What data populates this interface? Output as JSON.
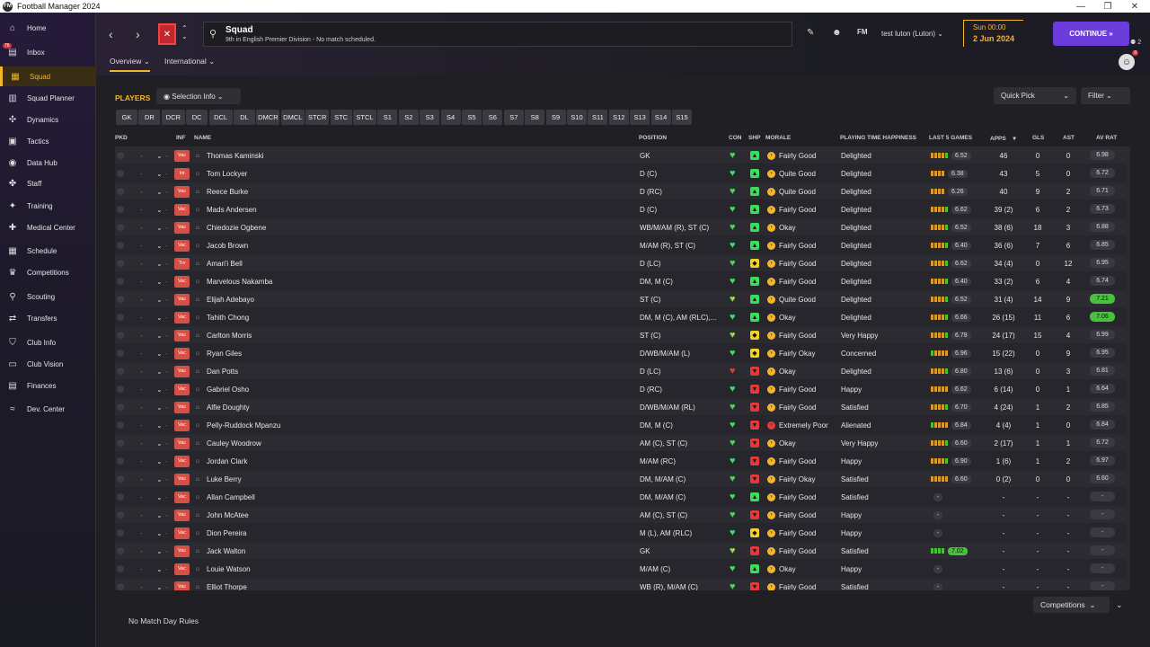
{
  "window": {
    "title": "Football Manager 2024",
    "logo": "FM"
  },
  "sidebar": {
    "items": [
      {
        "label": "Home",
        "icon": "home-icon",
        "glyph": "⌂",
        "badge": ""
      },
      {
        "label": "Inbox",
        "icon": "inbox-icon",
        "glyph": "▤",
        "badge": "76"
      },
      {
        "label": "Squad",
        "icon": "shirt-icon",
        "glyph": "▦",
        "badge": ""
      },
      {
        "label": "Squad Planner",
        "icon": "planner-icon",
        "glyph": "▥",
        "badge": ""
      },
      {
        "label": "Dynamics",
        "icon": "dynamics-icon",
        "glyph": "✣",
        "badge": ""
      },
      {
        "label": "Tactics",
        "icon": "tactics-icon",
        "glyph": "▣",
        "badge": ""
      },
      {
        "label": "Data Hub",
        "icon": "data-hub-icon",
        "glyph": "◉",
        "badge": ""
      },
      {
        "label": "Staff",
        "icon": "staff-icon",
        "glyph": "✤",
        "badge": ""
      },
      {
        "label": "Training",
        "icon": "training-icon",
        "glyph": "✦",
        "badge": ""
      },
      {
        "label": "Medical Center",
        "icon": "medical-icon",
        "glyph": "✚",
        "badge": ""
      },
      {
        "label": "Schedule",
        "icon": "calendar-icon",
        "glyph": "▦",
        "badge": ""
      },
      {
        "label": "Competitions",
        "icon": "trophy-icon",
        "glyph": "♛",
        "badge": ""
      },
      {
        "label": "Scouting",
        "icon": "scouting-icon",
        "glyph": "⚲",
        "badge": ""
      },
      {
        "label": "Transfers",
        "icon": "transfers-icon",
        "glyph": "⇄",
        "badge": ""
      },
      {
        "label": "Club Info",
        "icon": "shield-icon",
        "glyph": "⛉",
        "badge": ""
      },
      {
        "label": "Club Vision",
        "icon": "vision-icon",
        "glyph": "▭",
        "badge": ""
      },
      {
        "label": "Finances",
        "icon": "finances-icon",
        "glyph": "▤",
        "badge": ""
      },
      {
        "label": "Dev. Center",
        "icon": "dev-center-icon",
        "glyph": "≈",
        "badge": ""
      }
    ]
  },
  "header": {
    "title": "Squad",
    "subtitle": "9th in English Premier Division - No match scheduled.",
    "fm_label": "FM",
    "user": "test luton (Luton)",
    "time": "Sun 00:00",
    "date": "2 Jun 2024",
    "continue_label": "CONTINUE",
    "people_count": "2",
    "notif_count": "8"
  },
  "tabs": {
    "overview": "Overview",
    "international": "International"
  },
  "section": {
    "title": "PLAYERS",
    "selection_info": "Selection Info",
    "quick_pick": "Quick Pick",
    "filter": "Filter"
  },
  "positions": [
    "GK",
    "DR",
    "DCR",
    "DC",
    "DCL",
    "DL",
    "DMCR",
    "DMCL",
    "STCR",
    "STC",
    "STCL",
    "S1",
    "S2",
    "S3",
    "S4",
    "S5",
    "S6",
    "S7",
    "S8",
    "S9",
    "S10",
    "S11",
    "S12",
    "S13",
    "S14",
    "S15"
  ],
  "columns": {
    "pkd": "PKD",
    "inf": "INF",
    "name": "NAME",
    "position": "POSITION",
    "con": "CON",
    "shp": "SHP",
    "morale": "MORALE",
    "happiness": "PLAYING TIME HAPPINESS",
    "last5": "LAST 5 GAMES",
    "apps": "APPS",
    "gls": "GLS",
    "ast": "AST",
    "avrat": "AV RAT"
  },
  "players": [
    {
      "inf": "Vac",
      "name": "Thomas Kaminski",
      "position": "GK",
      "con": "green",
      "shp": "green",
      "morale": "Fairly Good",
      "mcol": "#f5b52a",
      "happiness": "Delighted",
      "form": [
        "o",
        "o",
        "o",
        "o",
        "g"
      ],
      "rating": "6.52",
      "apps": "46",
      "gls": "0",
      "ast": "0",
      "avrat": "6.98",
      "avhi": false
    },
    {
      "inf": "Int",
      "name": "Tom Lockyer",
      "position": "D (C)",
      "con": "green",
      "shp": "green",
      "morale": "Quite Good",
      "mcol": "#f5b52a",
      "happiness": "Delighted",
      "form": [
        "o",
        "o",
        "o",
        "o"
      ],
      "rating": "6.38",
      "apps": "43",
      "gls": "5",
      "ast": "0",
      "avrat": "6.72",
      "avhi": false
    },
    {
      "inf": "Vac",
      "name": "Reece Burke",
      "position": "D (RC)",
      "con": "green",
      "shp": "green",
      "morale": "Quite Good",
      "mcol": "#f5b52a",
      "happiness": "Delighted",
      "form": [
        "o",
        "o",
        "o",
        "o"
      ],
      "rating": "6.26",
      "apps": "40",
      "gls": "9",
      "ast": "2",
      "avrat": "6.71",
      "avhi": false
    },
    {
      "inf": "Vac",
      "name": "Mads Andersen",
      "position": "D (C)",
      "con": "green",
      "shp": "green",
      "morale": "Fairly Good",
      "mcol": "#f5b52a",
      "happiness": "Delighted",
      "form": [
        "o",
        "o",
        "o",
        "o",
        "g"
      ],
      "rating": "6.62",
      "apps": "39 (2)",
      "gls": "6",
      "ast": "2",
      "avrat": "6.73",
      "avhi": false
    },
    {
      "inf": "Vac",
      "name": "Chiedozie Ogbene",
      "position": "WB/M/AM (R), ST (C)",
      "con": "green",
      "shp": "green",
      "morale": "Okay",
      "mcol": "#f5b52a",
      "happiness": "Delighted",
      "form": [
        "o",
        "o",
        "o",
        "o",
        "g"
      ],
      "rating": "6.52",
      "apps": "38 (6)",
      "gls": "18",
      "ast": "3",
      "avrat": "6.88",
      "avhi": false
    },
    {
      "inf": "Vac",
      "name": "Jacob Brown",
      "position": "M/AM (R), ST (C)",
      "con": "green",
      "shp": "green",
      "morale": "Fairly Good",
      "mcol": "#f5b52a",
      "happiness": "Delighted",
      "form": [
        "o",
        "o",
        "o",
        "o",
        "g"
      ],
      "rating": "6.40",
      "apps": "36 (6)",
      "gls": "7",
      "ast": "6",
      "avrat": "6.85",
      "avhi": false
    },
    {
      "inf": "Trv",
      "name": "Amari'i Bell",
      "position": "D (LC)",
      "con": "green",
      "shp": "yellow",
      "morale": "Fairly Good",
      "mcol": "#f5b52a",
      "happiness": "Delighted",
      "form": [
        "o",
        "o",
        "o",
        "o",
        "g"
      ],
      "rating": "6.62",
      "apps": "34 (4)",
      "gls": "0",
      "ast": "12",
      "avrat": "6.95",
      "avhi": false
    },
    {
      "inf": "Vac",
      "name": "Marvelous Nakamba",
      "position": "DM, M (C)",
      "con": "green",
      "shp": "green",
      "morale": "Fairly Good",
      "mcol": "#f5b52a",
      "happiness": "Delighted",
      "form": [
        "o",
        "o",
        "o",
        "o",
        "g"
      ],
      "rating": "6.40",
      "apps": "33 (2)",
      "gls": "6",
      "ast": "4",
      "avrat": "6.74",
      "avhi": false
    },
    {
      "inf": "Vac",
      "name": "Elijah Adebayo",
      "position": "ST (C)",
      "con": "lime",
      "shp": "green",
      "morale": "Quite Good",
      "mcol": "#f5b52a",
      "happiness": "Delighted",
      "form": [
        "o",
        "o",
        "o",
        "o",
        "g"
      ],
      "rating": "6.52",
      "apps": "31 (4)",
      "gls": "14",
      "ast": "9",
      "avrat": "7.21",
      "avhi": true
    },
    {
      "inf": "Vac",
      "name": "Tahith Chong",
      "position": "DM, M (C), AM (RLC),...",
      "con": "green",
      "shp": "green",
      "morale": "Okay",
      "mcol": "#f5b52a",
      "happiness": "Delighted",
      "form": [
        "o",
        "o",
        "o",
        "o",
        "g"
      ],
      "rating": "6.66",
      "apps": "26 (15)",
      "gls": "11",
      "ast": "6",
      "avrat": "7.06",
      "avhi": true
    },
    {
      "inf": "Vac",
      "name": "Carlton Morris",
      "position": "ST (C)",
      "con": "lime",
      "shp": "yellow",
      "morale": "Fairly Good",
      "mcol": "#f5b52a",
      "happiness": "Very Happy",
      "form": [
        "o",
        "o",
        "o",
        "o",
        "g"
      ],
      "rating": "6.78",
      "apps": "24 (17)",
      "gls": "15",
      "ast": "4",
      "avrat": "6.99",
      "avhi": false
    },
    {
      "inf": "Vac",
      "name": "Ryan Giles",
      "position": "D/WB/M/AM (L)",
      "con": "green",
      "shp": "yellow",
      "morale": "Fairly Okay",
      "mcol": "#f5b52a",
      "happiness": "Concerned",
      "form": [
        "g",
        "o",
        "o",
        "o",
        "o"
      ],
      "rating": "6.96",
      "apps": "15 (22)",
      "gls": "0",
      "ast": "9",
      "avrat": "6.95",
      "avhi": false
    },
    {
      "inf": "Vac",
      "name": "Dan Potts",
      "position": "D (LC)",
      "con": "red",
      "shp": "red",
      "morale": "Okay",
      "mcol": "#f5b52a",
      "happiness": "Delighted",
      "form": [
        "o",
        "o",
        "o",
        "o",
        "g"
      ],
      "rating": "6.80",
      "apps": "13 (6)",
      "gls": "0",
      "ast": "3",
      "avrat": "6.81",
      "avhi": false
    },
    {
      "inf": "Vac",
      "name": "Gabriel Osho",
      "position": "D (RC)",
      "con": "green",
      "shp": "red",
      "morale": "Fairly Good",
      "mcol": "#f5b52a",
      "happiness": "Happy",
      "form": [
        "o",
        "o",
        "o",
        "o",
        "o"
      ],
      "rating": "6.62",
      "apps": "6 (14)",
      "gls": "0",
      "ast": "1",
      "avrat": "6.64",
      "avhi": false
    },
    {
      "inf": "Vac",
      "name": "Alfie Doughty",
      "position": "D/WB/M/AM (RL)",
      "con": "green",
      "shp": "red",
      "morale": "Fairly Good",
      "mcol": "#f5b52a",
      "happiness": "Satisfied",
      "form": [
        "o",
        "o",
        "o",
        "o",
        "g"
      ],
      "rating": "6.70",
      "apps": "4 (24)",
      "gls": "1",
      "ast": "2",
      "avrat": "6.85",
      "avhi": false
    },
    {
      "inf": "Vac",
      "name": "Pelly-Ruddock Mpanzu",
      "position": "DM, M (C)",
      "con": "green",
      "shp": "red",
      "morale": "Extremely Poor",
      "mcol": "#e03b3b",
      "happiness": "Alienated",
      "form": [
        "g",
        "o",
        "o",
        "o",
        "o"
      ],
      "rating": "6.84",
      "apps": "4 (4)",
      "gls": "1",
      "ast": "0",
      "avrat": "6.84",
      "avhi": false
    },
    {
      "inf": "Vac",
      "name": "Cauley Woodrow",
      "position": "AM (C), ST (C)",
      "con": "green",
      "shp": "red",
      "morale": "Okay",
      "mcol": "#f5b52a",
      "happiness": "Very Happy",
      "form": [
        "o",
        "o",
        "o",
        "o",
        "g"
      ],
      "rating": "6.60",
      "apps": "2 (17)",
      "gls": "1",
      "ast": "1",
      "avrat": "6.72",
      "avhi": false
    },
    {
      "inf": "Vac",
      "name": "Jordan Clark",
      "position": "M/AM (RC)",
      "con": "green",
      "shp": "red",
      "morale": "Fairly Good",
      "mcol": "#f5b52a",
      "happiness": "Happy",
      "form": [
        "o",
        "o",
        "o",
        "o",
        "g"
      ],
      "rating": "6.90",
      "apps": "1 (6)",
      "gls": "1",
      "ast": "2",
      "avrat": "6.97",
      "avhi": false
    },
    {
      "inf": "Vac",
      "name": "Luke Berry",
      "position": "DM, M/AM (C)",
      "con": "green",
      "shp": "red",
      "morale": "Fairly Okay",
      "mcol": "#f5b52a",
      "happiness": "Satisfied",
      "form": [
        "o",
        "o",
        "o",
        "o",
        "o"
      ],
      "rating": "6.60",
      "apps": "0 (2)",
      "gls": "0",
      "ast": "0",
      "avrat": "6.60",
      "avhi": false
    },
    {
      "inf": "Vac",
      "name": "Allan Campbell",
      "position": "DM, M/AM (C)",
      "con": "green",
      "shp": "green",
      "morale": "Fairly Good",
      "mcol": "#f5b52a",
      "happiness": "Satisfied",
      "form": [],
      "rating": "-",
      "apps": "-",
      "gls": "-",
      "ast": "-",
      "avrat": "-",
      "avhi": false
    },
    {
      "inf": "Vac",
      "name": "John McAtee",
      "position": "AM (C), ST (C)",
      "con": "green",
      "shp": "red",
      "morale": "Fairly Good",
      "mcol": "#f5b52a",
      "happiness": "Happy",
      "form": [],
      "rating": "-",
      "apps": "-",
      "gls": "-",
      "ast": "-",
      "avrat": "-",
      "avhi": false
    },
    {
      "inf": "Vac",
      "name": "Dion Pereira",
      "position": "M (L), AM (RLC)",
      "con": "green",
      "shp": "yellow",
      "morale": "Fairly Good",
      "mcol": "#f5b52a",
      "happiness": "Happy",
      "form": [],
      "rating": "-",
      "apps": "-",
      "gls": "-",
      "ast": "-",
      "avrat": "-",
      "avhi": false
    },
    {
      "inf": "Vac",
      "name": "Jack Walton",
      "position": "GK",
      "con": "lime",
      "shp": "red",
      "morale": "Fairly Good",
      "mcol": "#f5b52a",
      "happiness": "Satisfied",
      "form": [
        "g",
        "g",
        "g",
        "g"
      ],
      "rating": "7.02",
      "ratinghi": true,
      "apps": "-",
      "gls": "-",
      "ast": "-",
      "avrat": "-",
      "avhi": false
    },
    {
      "inf": "Vac",
      "name": "Louie Watson",
      "position": "M/AM (C)",
      "con": "green",
      "shp": "green",
      "morale": "Okay",
      "mcol": "#f5b52a",
      "happiness": "Happy",
      "form": [],
      "rating": "-",
      "apps": "-",
      "gls": "-",
      "ast": "-",
      "avrat": "-",
      "avhi": false
    },
    {
      "inf": "Vac",
      "name": "Elliot Thorpe",
      "position": "WB (R), M/AM (C)",
      "con": "green",
      "shp": "red",
      "morale": "Fairly Good",
      "mcol": "#f5b52a",
      "happiness": "Satisfied",
      "form": [],
      "rating": "-",
      "apps": "-",
      "gls": "-",
      "ast": "-",
      "avrat": "-",
      "avhi": false
    }
  ],
  "footer": {
    "note": "No Match Day Rules",
    "competitions": "Competitions"
  },
  "colors": {
    "accent": "#f5b52a",
    "continue": "#6b3ddc",
    "status_green": "#3ddc5a",
    "status_red": "#e03b3b",
    "form_orange": "#d99a2b",
    "form_green": "#49c23b"
  }
}
